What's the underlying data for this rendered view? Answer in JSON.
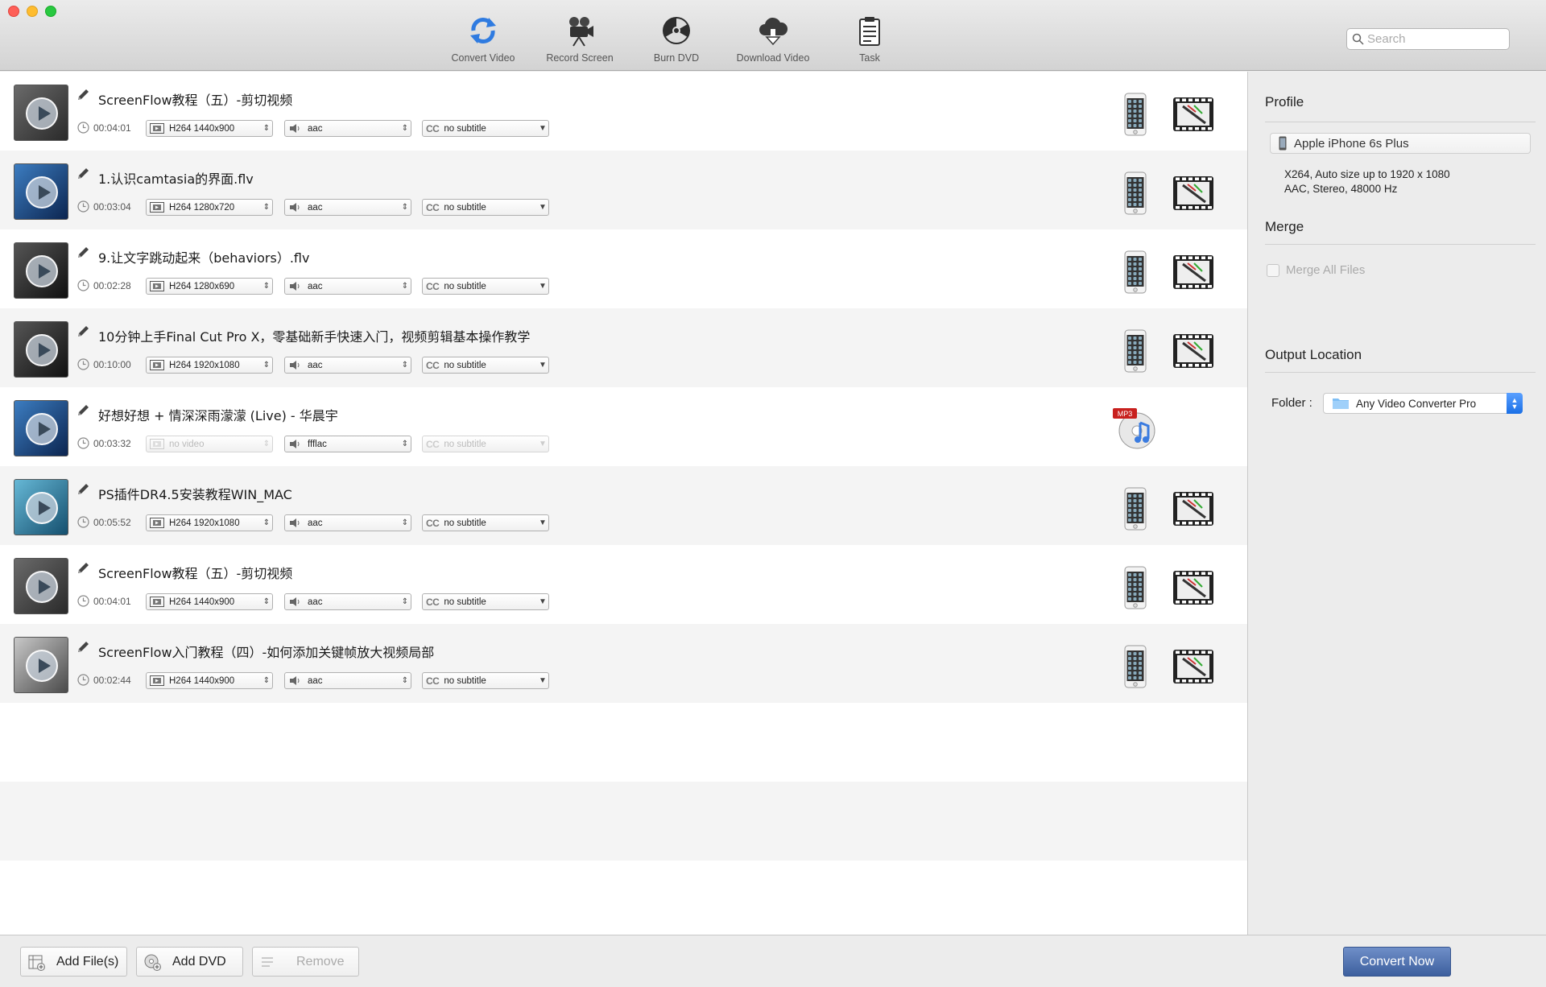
{
  "toolbar": {
    "items": [
      {
        "label": "Convert Video",
        "icon": "convert-icon"
      },
      {
        "label": "Record Screen",
        "icon": "camera-icon"
      },
      {
        "label": "Burn DVD",
        "icon": "radiation-icon"
      },
      {
        "label": "Download Video",
        "icon": "cloud-download-icon"
      },
      {
        "label": "Task",
        "icon": "clipboard-icon"
      }
    ],
    "search_placeholder": "Search"
  },
  "files": [
    {
      "title": "ScreenFlow教程（五）-剪切视频",
      "duration": "00:04:01",
      "video": "H264 1440x900",
      "audio": "aac",
      "subtitle": "no subtitle",
      "output": "device"
    },
    {
      "title": "1.认识camtasia的界面.flv",
      "duration": "00:03:04",
      "video": "H264 1280x720",
      "audio": "aac",
      "subtitle": "no subtitle",
      "output": "device"
    },
    {
      "title": "9.让文字跳动起来（behaviors）.flv",
      "duration": "00:02:28",
      "video": "H264 1280x690",
      "audio": "aac",
      "subtitle": "no subtitle",
      "output": "device"
    },
    {
      "title": "10分钟上手Final Cut Pro X，零基础新手快速入门，视频剪辑基本操作教学",
      "duration": "00:10:00",
      "video": "H264 1920x1080",
      "audio": "aac",
      "subtitle": "no subtitle",
      "output": "device"
    },
    {
      "title": "好想好想 + 情深深雨濛濛 (Live) - 华晨宇",
      "duration": "00:03:32",
      "video": "no video",
      "audio": "ffflac",
      "subtitle": "no subtitle",
      "output": "mp3"
    },
    {
      "title": "PS插件DR4.5安装教程WIN_MAC",
      "duration": "00:05:52",
      "video": "H264 1920x1080",
      "audio": "aac",
      "subtitle": "no subtitle",
      "output": "device"
    },
    {
      "title": "ScreenFlow教程（五）-剪切视频",
      "duration": "00:04:01",
      "video": "H264 1440x900",
      "audio": "aac",
      "subtitle": "no subtitle",
      "output": "device"
    },
    {
      "title": "ScreenFlow入门教程（四）-如何添加关键帧放大视频局部",
      "duration": "00:02:44",
      "video": "H264 1440x900",
      "audio": "aac",
      "subtitle": "no subtitle",
      "output": "device"
    }
  ],
  "mp3_badge": "MP3",
  "panel": {
    "profile_heading": "Profile",
    "profile_name": "Apple iPhone 6s Plus",
    "profile_desc_1": "X264, Auto size up to 1920 x 1080",
    "profile_desc_2": "AAC, Stereo, 48000 Hz",
    "merge_heading": "Merge",
    "merge_label": "Merge All Files",
    "output_heading": "Output Location",
    "folder_label": "Folder :",
    "folder_value": "Any Video Converter Pro"
  },
  "bottom": {
    "add_files": "Add File(s)",
    "add_dvd": "Add DVD",
    "remove": "Remove",
    "convert": "Convert Now"
  }
}
